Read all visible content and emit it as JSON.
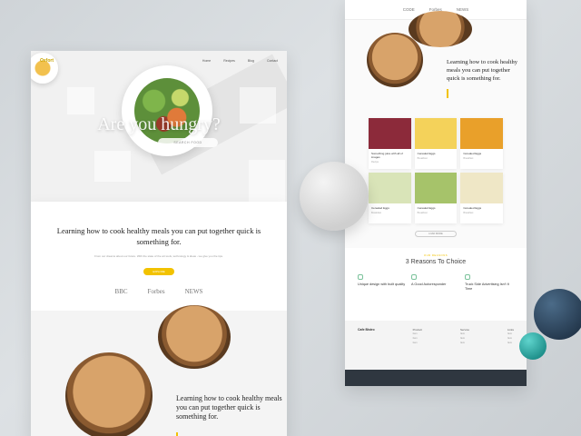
{
  "left": {
    "logo": "Oxfort",
    "menu": [
      "Home",
      "Recipes",
      "Blog",
      "Contact"
    ],
    "hero_title": "Are you hungry?",
    "hero_button": "SEARCH FOOD",
    "intro_heading": "Learning how to cook healthy meals you can put together quick is something for.",
    "intro_body": "From our dreams about our future. With the state of the art tools, technology & ideas - we give you the tips.",
    "intro_button": "EXPLORE",
    "press": [
      "BBC",
      "Forbes",
      "NEWS"
    ],
    "lower_heading": "Learning how to cook healthy meals you can put together quick is something for."
  },
  "right": {
    "logos": [
      "CODE",
      "Forbes",
      "NEWS"
    ],
    "intro_heading": "Learning how to cook healthy meals you can put together quick is something for.",
    "cards": [
      {
        "title": "Something juice with all of images",
        "meta": "Recipe",
        "color": "#8c2a3a"
      },
      {
        "title": "Cerealed Eggs",
        "meta": "Breakfast",
        "color": "#f4d25a"
      },
      {
        "title": "Cerealed Eggs",
        "meta": "Breakfast",
        "color": "#e9a02a"
      },
      {
        "title": "Cerealed Eggs",
        "meta": "Breakfast",
        "color": "#d9e4b8"
      },
      {
        "title": "Cerealed Eggs",
        "meta": "Breakfast",
        "color": "#a6c36a"
      },
      {
        "title": "Cerealed Eggs",
        "meta": "Breakfast",
        "color": "#efe7c6"
      }
    ],
    "more_button": "LOAD MORE",
    "reasons_small": "OUR REASONS",
    "reasons_heading": "3 Reasons To Choice",
    "reasons": [
      "Unique design with built quality",
      "A Good Autoresponder",
      "Truck Side Advertising Isn't It Time"
    ],
    "footer_brand": "Cafe Bistro",
    "footer_cols": [
      {
        "h": "Product",
        "items": [
          "Item",
          "Item",
          "Item",
          "Item"
        ]
      },
      {
        "h": "Service",
        "items": [
          "Item",
          "Item",
          "Item",
          "Item"
        ]
      },
      {
        "h": "Links",
        "items": [
          "Item",
          "Item",
          "Item",
          "Item"
        ]
      }
    ]
  }
}
